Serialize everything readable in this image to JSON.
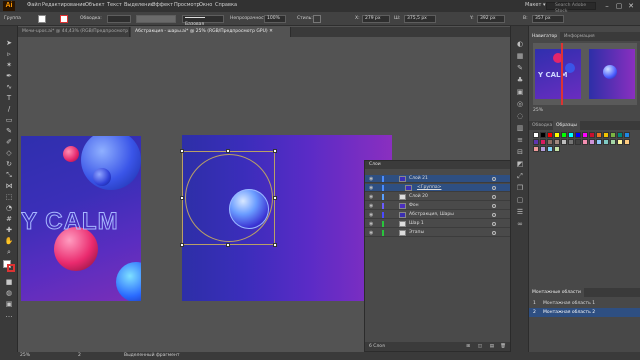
{
  "menu": {
    "logo": "Ai",
    "items": [
      "Файл",
      "Редактирование",
      "Объект",
      "Текст",
      "Выделение",
      "Эффект",
      "Просмотр",
      "Окно",
      "Справка"
    ],
    "workspace": "Макет ▾",
    "search_placeholder": "Search Adobe Stock"
  },
  "control": {
    "selection_label": "Группа",
    "stroke_label": "Обводка:",
    "brush_label": "Базовая",
    "opacity_label": "Непрозрачность:",
    "opacity_value": "100%",
    "styles_label": "Стиль:",
    "x_label": "X:",
    "x_value": "279 px",
    "w_label": "Ш:",
    "w_value": "375,5 px",
    "y_label": "Y:",
    "y_value": "392 px",
    "h_label": "В:",
    "h_value": "357 px"
  },
  "tabs": [
    "Мечи-upos.ai* @ 44,43% (RGB/Предпросмотр GPU)",
    "Абстракция - шары.ai* @ 25% (RGB/Предпросмотр GPU)"
  ],
  "left_artboard": {
    "text": "Y CALM"
  },
  "layers_panel": {
    "title": "Слои",
    "rows": [
      {
        "name": "Слой 21",
        "color": "#4a8cff",
        "selected": true
      },
      {
        "name": "<Группа>",
        "color": "#4a8cff",
        "selected": true
      },
      {
        "name": "Слой 20",
        "color": "#5aa0ff",
        "selected": false
      },
      {
        "name": "Фон",
        "color": "#6a5cff",
        "selected": false
      },
      {
        "name": "Абстракция, Шары",
        "color": "#4a4aff",
        "selected": false
      },
      {
        "name": "Шар 1",
        "color": "#28c43c",
        "selected": false
      },
      {
        "name": "Этапы",
        "color": "#28c43c",
        "selected": false
      }
    ],
    "footer": "6 Слоя"
  },
  "navigator": {
    "tabs": [
      "Навигатор",
      "Информация"
    ],
    "zoom": "25%"
  },
  "swatches": {
    "tabs": [
      "Обводка",
      "Образцы"
    ]
  },
  "artboards_panel": {
    "title": "Монтажные области",
    "rows": [
      {
        "num": "1",
        "name": "Монтажная область 1"
      },
      {
        "num": "2",
        "name": "Монтажная область 2"
      }
    ]
  },
  "status": {
    "zoom": "25%",
    "page": "2",
    "mode": "Выделенный фрагмент"
  }
}
